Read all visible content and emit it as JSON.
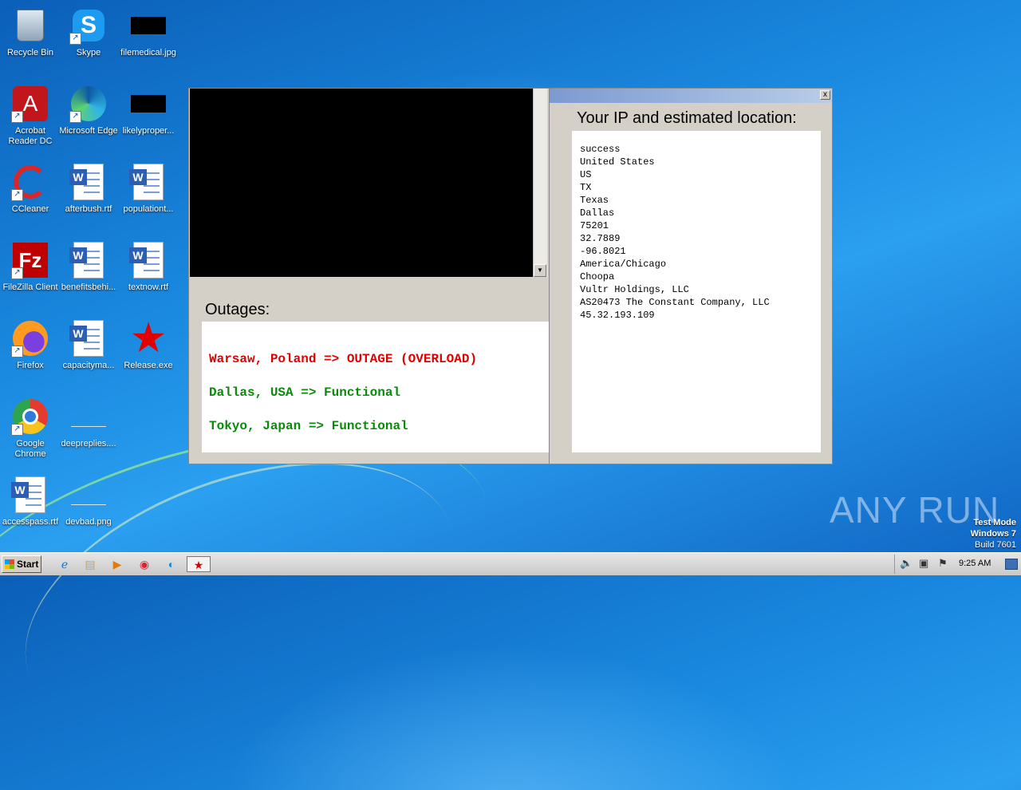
{
  "desktop": {
    "icons": [
      {
        "label": "Recycle Bin"
      },
      {
        "label": "Skype"
      },
      {
        "label": "filemedical.jpg"
      },
      {
        "label": "Acrobat Reader DC"
      },
      {
        "label": "Microsoft Edge"
      },
      {
        "label": "likelyproper..."
      },
      {
        "label": "CCleaner"
      },
      {
        "label": "afterbush.rtf"
      },
      {
        "label": "populationt..."
      },
      {
        "label": "FileZilla Client"
      },
      {
        "label": "benefitsbehi..."
      },
      {
        "label": "textnow.rtf"
      },
      {
        "label": "Firefox"
      },
      {
        "label": "capacityma..."
      },
      {
        "label": "Release.exe"
      },
      {
        "label": "Google Chrome"
      },
      {
        "label": "deepreplies...."
      },
      {
        "label": "accesspass.rtf"
      },
      {
        "label": "devbad.png"
      }
    ]
  },
  "outages": {
    "title": "Outages:",
    "lines": [
      {
        "text": "Warsaw, Poland => OUTAGE (OVERLOAD)",
        "color": "#e00000"
      },
      {
        "text": "Dallas, USA => Functional",
        "color": "#0a8a0a"
      },
      {
        "text": "Tokyo, Japan => Functional",
        "color": "#0a8a0a"
      }
    ]
  },
  "ip_window": {
    "title": "Your IP and estimated location:",
    "close_label": "x",
    "lines": [
      "success",
      "United States",
      "US",
      "TX",
      "Texas",
      "Dallas",
      "75201",
      "32.7889",
      "-96.8021",
      "America/Chicago",
      "Choopa",
      "Vultr Holdings, LLC",
      "AS20473 The Constant Company, LLC",
      "45.32.193.109"
    ]
  },
  "watermark": {
    "brand": "ANY RUN",
    "mode": "Test Mode",
    "os": "Windows 7",
    "build": "Build 7601"
  },
  "taskbar": {
    "start_label": "Start",
    "clock": "9:25 AM"
  }
}
